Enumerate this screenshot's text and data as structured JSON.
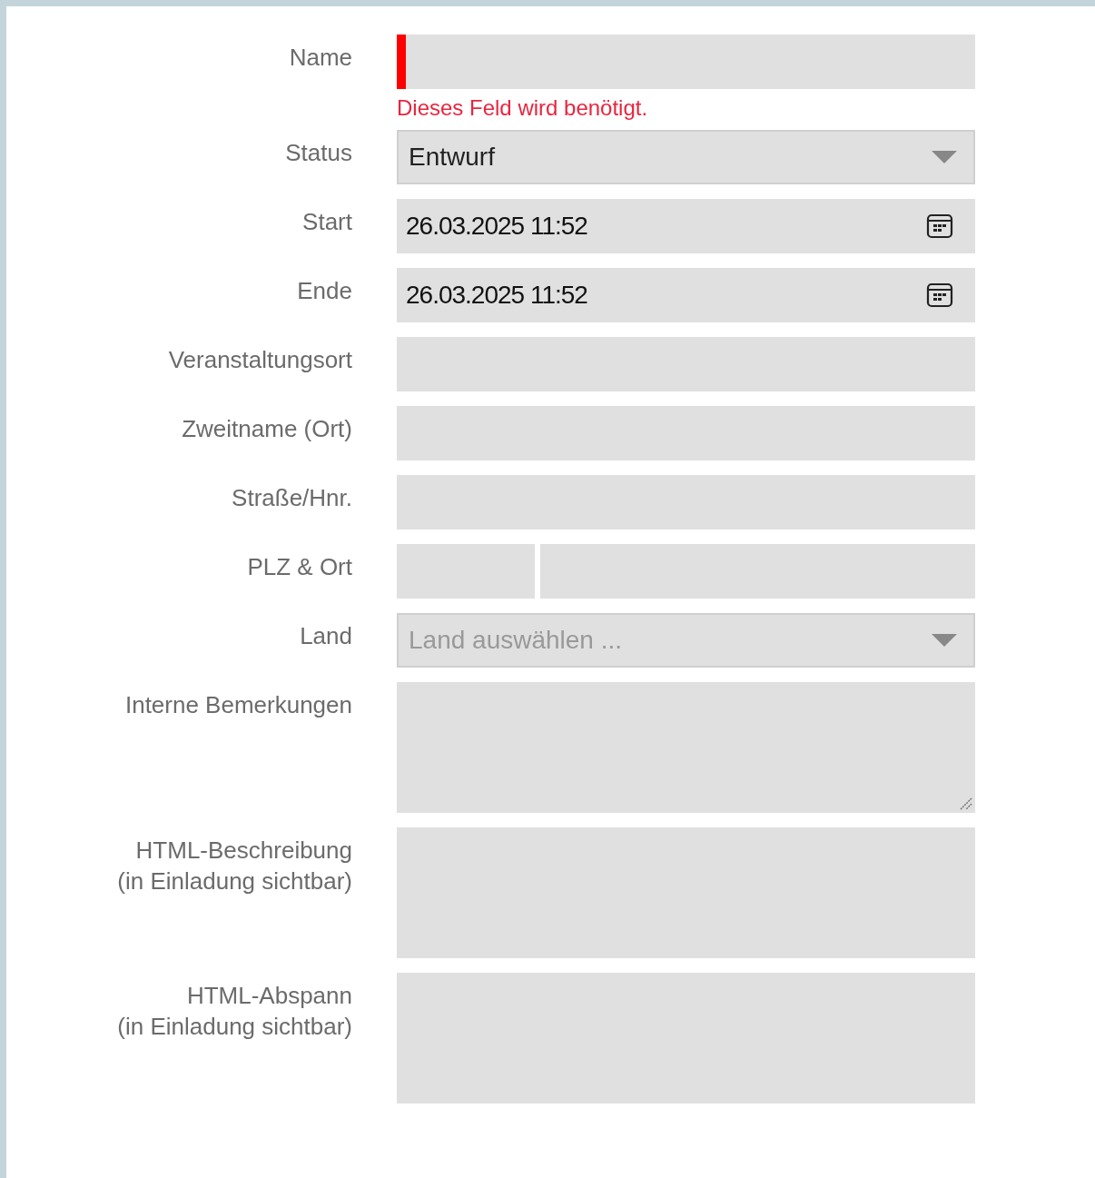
{
  "fields": [
    {
      "kind": "text",
      "label": "Name",
      "invalid": true,
      "error": "Dieses Feld wird benötigt."
    },
    {
      "kind": "select",
      "label": "Status",
      "value": "Entwurf"
    },
    {
      "kind": "datetime",
      "label": "Start",
      "value": "26.03.2025 11:52"
    },
    {
      "kind": "datetime",
      "label": "Ende",
      "value": "26.03.2025 11:52"
    },
    {
      "kind": "text",
      "label": "Veranstaltungsort",
      "invalid": false
    },
    {
      "kind": "text",
      "label": "Zweitname (Ort)",
      "invalid": false
    },
    {
      "kind": "text",
      "label": "Straße/Hnr.",
      "invalid": false
    },
    {
      "kind": "split",
      "label": "PLZ & Ort"
    },
    {
      "kind": "select",
      "label": "Land",
      "placeholder": "Land auswählen ..."
    },
    {
      "kind": "textarea",
      "label": "Interne Bemerkungen",
      "resizable": true
    },
    {
      "kind": "textarea",
      "label": "HTML-Beschreibung\n(in Einladung sichtbar)",
      "resizable": false
    },
    {
      "kind": "textarea",
      "label": "HTML-Abspann\n(in Einladung sichtbar)",
      "resizable": false
    }
  ]
}
